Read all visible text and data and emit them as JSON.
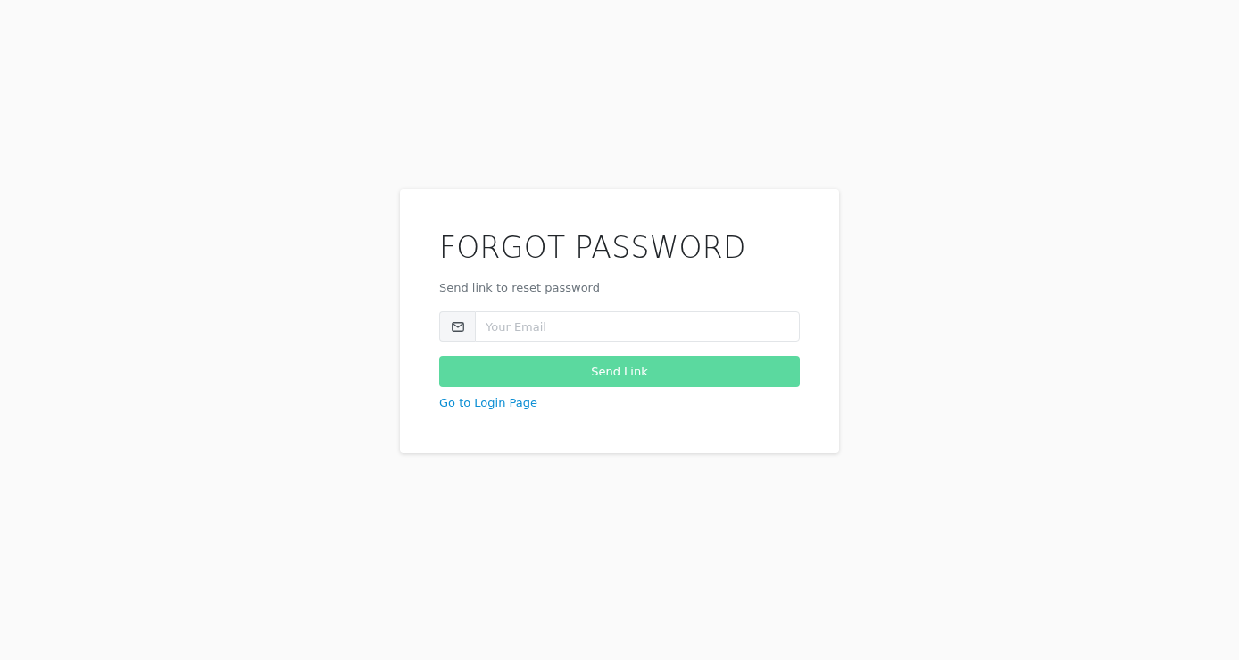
{
  "card": {
    "title": "FORGOT PASSWORD",
    "subtitle": "Send link to reset password",
    "email_field": {
      "placeholder": "Your Email"
    },
    "submit_button": "Send Link",
    "login_link": "Go to Login Page"
  }
}
